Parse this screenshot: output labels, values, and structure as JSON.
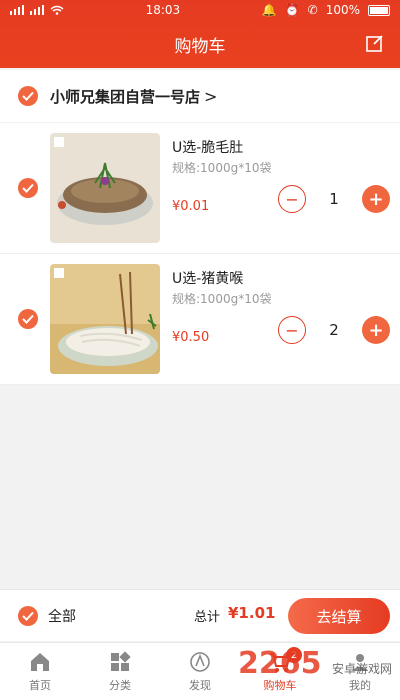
{
  "status": {
    "time": "18:03",
    "battery": "100%"
  },
  "header": {
    "title": "购物车"
  },
  "store": {
    "name": "小师兄集团自营一号店"
  },
  "items": [
    {
      "title": "U选-脆毛肚",
      "spec": "规格:1000g*10袋",
      "price": "¥0.01",
      "qty": "1"
    },
    {
      "title": "U选-猪黄喉",
      "spec": "规格:1000g*10袋",
      "price": "¥0.50",
      "qty": "2"
    }
  ],
  "checkout": {
    "all_label": "全部",
    "total_label": "总计",
    "total_value": "¥1.01",
    "pay_label": "去结算"
  },
  "tabs": [
    {
      "label": "首页",
      "icon": "home-icon"
    },
    {
      "label": "分类",
      "icon": "category-icon"
    },
    {
      "label": "发现",
      "icon": "discover-icon"
    },
    {
      "label": "购物车",
      "icon": "cart-icon",
      "badge": "2"
    },
    {
      "label": "我的",
      "icon": "user-icon"
    }
  ],
  "watermark": {
    "text": "2265",
    "sub": "安卓游戏网"
  },
  "colors": {
    "accent": "#e53b22",
    "check": "#f0663f"
  }
}
